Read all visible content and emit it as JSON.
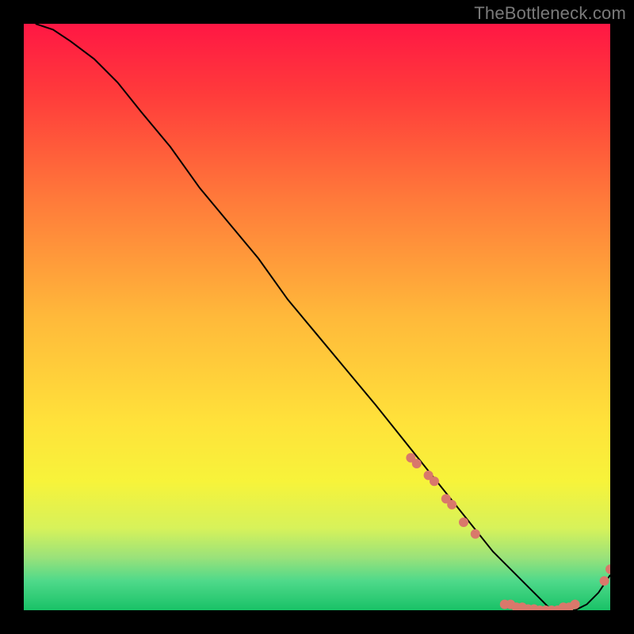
{
  "watermark": "TheBottleneck.com",
  "chart_data": {
    "type": "line",
    "title": "",
    "xlabel": "",
    "ylabel": "",
    "xlim": [
      0,
      100
    ],
    "ylim": [
      0,
      100
    ],
    "grid": false,
    "legend": false,
    "background_gradient": {
      "stops": [
        {
          "offset": 0.0,
          "color": "#ff1744"
        },
        {
          "offset": 0.12,
          "color": "#ff3b3b"
        },
        {
          "offset": 0.3,
          "color": "#ff7a3a"
        },
        {
          "offset": 0.5,
          "color": "#ffb93a"
        },
        {
          "offset": 0.68,
          "color": "#ffe23a"
        },
        {
          "offset": 0.78,
          "color": "#f7f33a"
        },
        {
          "offset": 0.86,
          "color": "#d7f25a"
        },
        {
          "offset": 0.91,
          "color": "#9ae27a"
        },
        {
          "offset": 0.95,
          "color": "#4fd98a"
        },
        {
          "offset": 1.0,
          "color": "#19c267"
        }
      ]
    },
    "series": [
      {
        "name": "bottleneck-curve",
        "color": "#000000",
        "x": [
          2,
          5,
          8,
          12,
          16,
          20,
          25,
          30,
          35,
          40,
          45,
          50,
          55,
          60,
          64,
          68,
          72,
          76,
          80,
          83,
          86,
          88,
          90,
          92,
          94,
          96,
          98,
          100
        ],
        "y": [
          100,
          99,
          97,
          94,
          90,
          85,
          79,
          72,
          66,
          60,
          53,
          47,
          41,
          35,
          30,
          25,
          20,
          15,
          10,
          7,
          4,
          2,
          0,
          0,
          0,
          1,
          3,
          6
        ]
      }
    ],
    "markers": {
      "name": "highlight-dots",
      "color": "#d9786b",
      "radius": 6,
      "points": [
        {
          "x": 66,
          "y": 26
        },
        {
          "x": 67,
          "y": 25
        },
        {
          "x": 69,
          "y": 23
        },
        {
          "x": 70,
          "y": 22
        },
        {
          "x": 72,
          "y": 19
        },
        {
          "x": 73,
          "y": 18
        },
        {
          "x": 75,
          "y": 15
        },
        {
          "x": 77,
          "y": 13
        },
        {
          "x": 82,
          "y": 1
        },
        {
          "x": 83,
          "y": 1
        },
        {
          "x": 84,
          "y": 0.5
        },
        {
          "x": 85,
          "y": 0.5
        },
        {
          "x": 86,
          "y": 0.2
        },
        {
          "x": 87,
          "y": 0.2
        },
        {
          "x": 88,
          "y": 0
        },
        {
          "x": 89,
          "y": 0
        },
        {
          "x": 90,
          "y": 0
        },
        {
          "x": 91,
          "y": 0
        },
        {
          "x": 92,
          "y": 0.5
        },
        {
          "x": 93,
          "y": 0.5
        },
        {
          "x": 94,
          "y": 1
        },
        {
          "x": 99,
          "y": 5
        },
        {
          "x": 100,
          "y": 7
        }
      ]
    }
  }
}
